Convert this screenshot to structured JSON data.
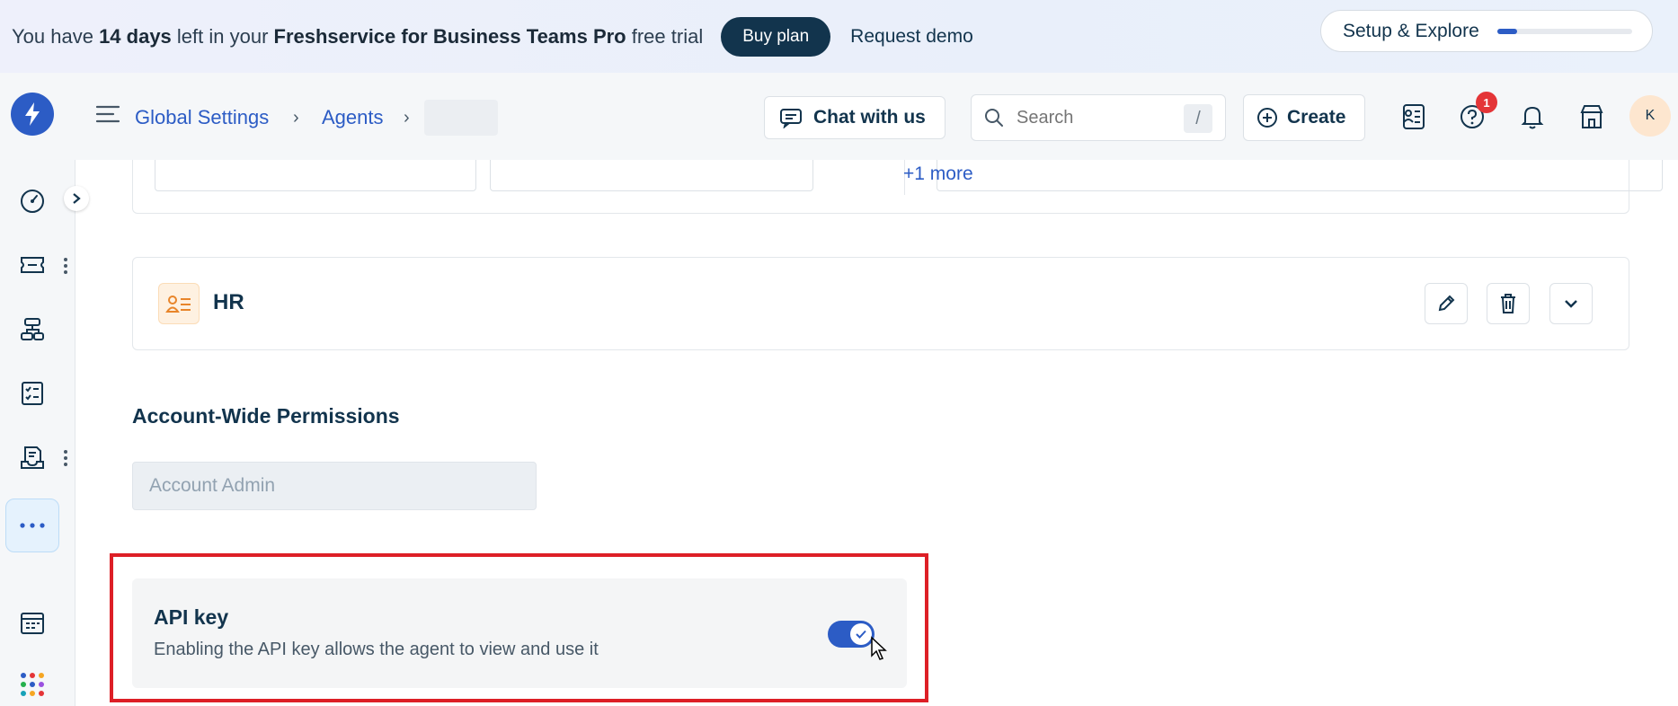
{
  "banner": {
    "text_prefix": "You have ",
    "days": "14 days",
    "text_middle": " left in your ",
    "plan_name": "Freshservice for Business Teams Pro",
    "text_suffix": " free trial",
    "buy_label": "Buy plan",
    "demo_label": "Request demo",
    "setup_label": "Setup & Explore",
    "setup_progress": 0.15
  },
  "header": {
    "breadcrumbs": [
      "Global Settings",
      "Agents"
    ],
    "chat_label": "Chat with us",
    "search_placeholder": "Search",
    "search_shortcut": "/",
    "create_label": "Create",
    "help_badge": "1",
    "avatar_initial": "K"
  },
  "content": {
    "more_link": "+1 more",
    "group": {
      "name": "HR"
    },
    "section_title": "Account-Wide Permissions",
    "role": "Account Admin",
    "api": {
      "title": "API key",
      "description": "Enabling the API key allows the agent to view and use it",
      "enabled": true
    }
  },
  "colors": {
    "brand": "#2c5cc5",
    "dark": "#12344d",
    "highlight": "#dd1f26",
    "badge": "#e43538"
  },
  "icons": [
    "logo-icon",
    "menu-icon",
    "chat-icon",
    "search-icon",
    "plus-circle-icon",
    "contacts-icon",
    "help-icon",
    "bell-icon",
    "store-icon",
    "dashboard-icon",
    "ticket-icon",
    "workflow-icon",
    "checklist-icon",
    "inbox-icon",
    "more-icon",
    "calendar-icon",
    "apps-grid-icon",
    "edit-icon",
    "trash-icon",
    "chevron-down-icon",
    "check-icon"
  ]
}
